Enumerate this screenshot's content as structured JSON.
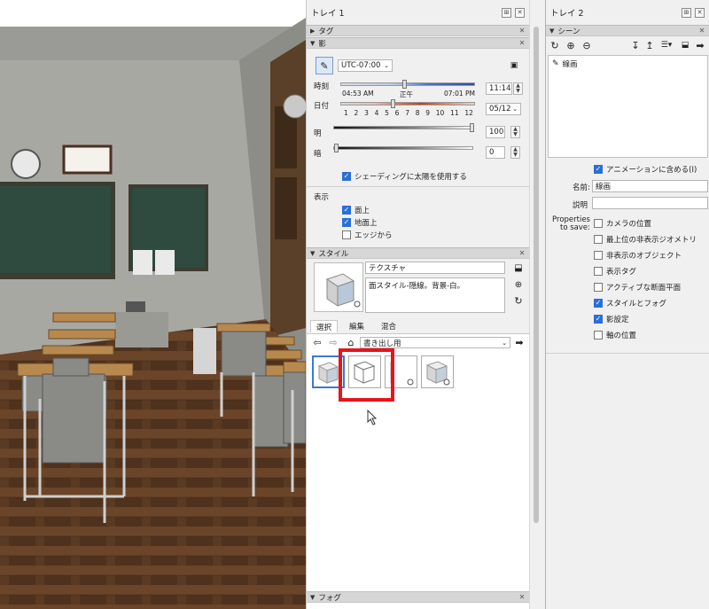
{
  "viewport": {
    "label": "3D classroom model view"
  },
  "tray1": {
    "title": "トレイ 1",
    "sections": {
      "tags": "タグ",
      "shadows": "影",
      "styles": "スタイル",
      "fog": "フォグ"
    },
    "shadows": {
      "timezone": "UTC-07:00",
      "time_label": "時刻",
      "time_start": "04:53 AM",
      "time_noon": "正午",
      "time_end": "07:01 PM",
      "time_value": "11:14",
      "date_label": "日付",
      "months": [
        "1",
        "2",
        "3",
        "4",
        "5",
        "6",
        "7",
        "8",
        "9",
        "10",
        "11",
        "12"
      ],
      "date_value": "05/12",
      "light_label": "明",
      "light_value": "100",
      "dark_label": "暗",
      "dark_value": "0",
      "use_sun_label": "シェーディングに太陽を使用する",
      "display_label": "表示",
      "on_faces": "面上",
      "on_ground": "地面上",
      "from_edges": "エッジから"
    },
    "styles": {
      "style_name": "テクスチャ",
      "style_desc": "面スタイル-隠線。背景-白。",
      "tabs": [
        "選択",
        "編集",
        "混合"
      ],
      "collection": "書き出し用"
    }
  },
  "tray2": {
    "title": "トレイ 2",
    "section": "シーン",
    "scene_item": "線画",
    "include_animation": "アニメーションに含める(I)",
    "name_label": "名前:",
    "name_value": "線画",
    "desc_label": "説明",
    "props_label": "Properties to save:",
    "props": [
      {
        "label": "カメラの位置",
        "checked": false
      },
      {
        "label": "最上位の非表示ジオメトリ",
        "checked": false
      },
      {
        "label": "非表示のオブジェクト",
        "checked": false
      },
      {
        "label": "表示タグ",
        "checked": false
      },
      {
        "label": "アクティブな断面平面",
        "checked": false
      },
      {
        "label": "スタイルとフォグ",
        "checked": true
      },
      {
        "label": "影設定",
        "checked": true
      },
      {
        "label": "軸の位置",
        "checked": false
      }
    ]
  },
  "colors": {
    "accent": "#2a6fd6",
    "highlight": "#e8141a"
  }
}
